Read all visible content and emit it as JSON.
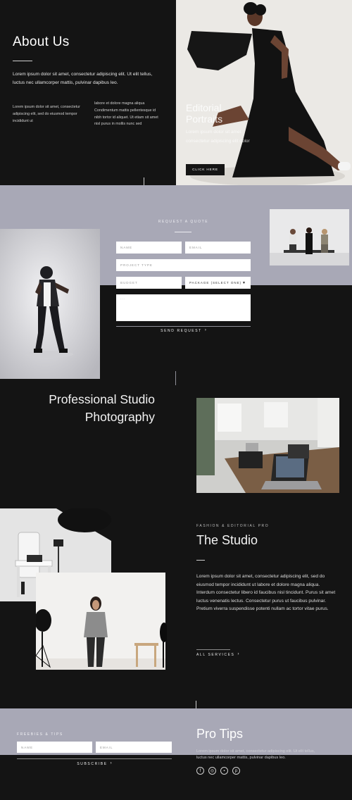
{
  "about": {
    "title": "About Us",
    "intro": "Lorem ipsum dolor sit amet, consectetur adipiscing elit. Ut elit tellus, luctus nec ullamcorper mattis, pulvinar dapibus leo.",
    "col_left": "Lorem ipsum dolor sit amet, consectetur adipiscing elit, sed do eiusmod tempor incididunt ut",
    "col_right": "labore et dolore magna aliqua Condimentum mattis pellentesque id nibh tortor id aliquet. Ut etiam sit amet nisl purus in mollis nunc sed"
  },
  "hero": {
    "title_line1": "Editorial",
    "title_line2": "Portraits",
    "text": "Lorem ipsum dolor sit amet consectetur adipiscing elit dolor",
    "button": "CLICK HERE"
  },
  "quote": {
    "heading": "REQUEST A QUOTE",
    "name_placeholder": "NAME",
    "email_placeholder": "EMAIL",
    "project_placeholder": "PROJECT TYPE",
    "budget_placeholder": "BUDGET",
    "package_select": "PACKAGE (SELECT ONE)",
    "message_placeholder": "...",
    "send": "SEND REQUEST"
  },
  "professional": {
    "line1": "Professional Studio",
    "line2": "Photography"
  },
  "studio": {
    "eyebrow": "FASHION & EDITORIAL PRO",
    "title": "The Studio",
    "body": "Lorem ipsum dolor sit amet, consectetur adipiscing elit, sed do eiusmod tempor incididunt ut labore et dolore magna aliqua. Interdum consectetur libero id faucibus nisl tincidunt. Purus sit amet luctus venenatis lectus. Consectetur purus ut faucibus pulvinar. Pretium viverra suspendisse potenti nullam ac tortor vitae purus.",
    "link": "ALL SERVICES"
  },
  "freebies": {
    "eyebrow": "FREEBIES & TIPS",
    "name_placeholder": "NAME",
    "email_placeholder": "EMAIL",
    "subscribe": "SUBSCRIBE"
  },
  "tips": {
    "title": "Pro Tips",
    "text": "Lorem ipsum dolor sit amet, consectetur adipiscing elit. Ut elit tellus, luctus nec ullamcorper mattis, pulvinar dapibus leo."
  },
  "social": [
    "facebook-icon",
    "instagram-icon",
    "youtube-icon",
    "pinterest-icon"
  ],
  "colors": {
    "dark": "#141414",
    "lavender": "#a8a8b6",
    "light_gray": "#dcdcdc"
  }
}
